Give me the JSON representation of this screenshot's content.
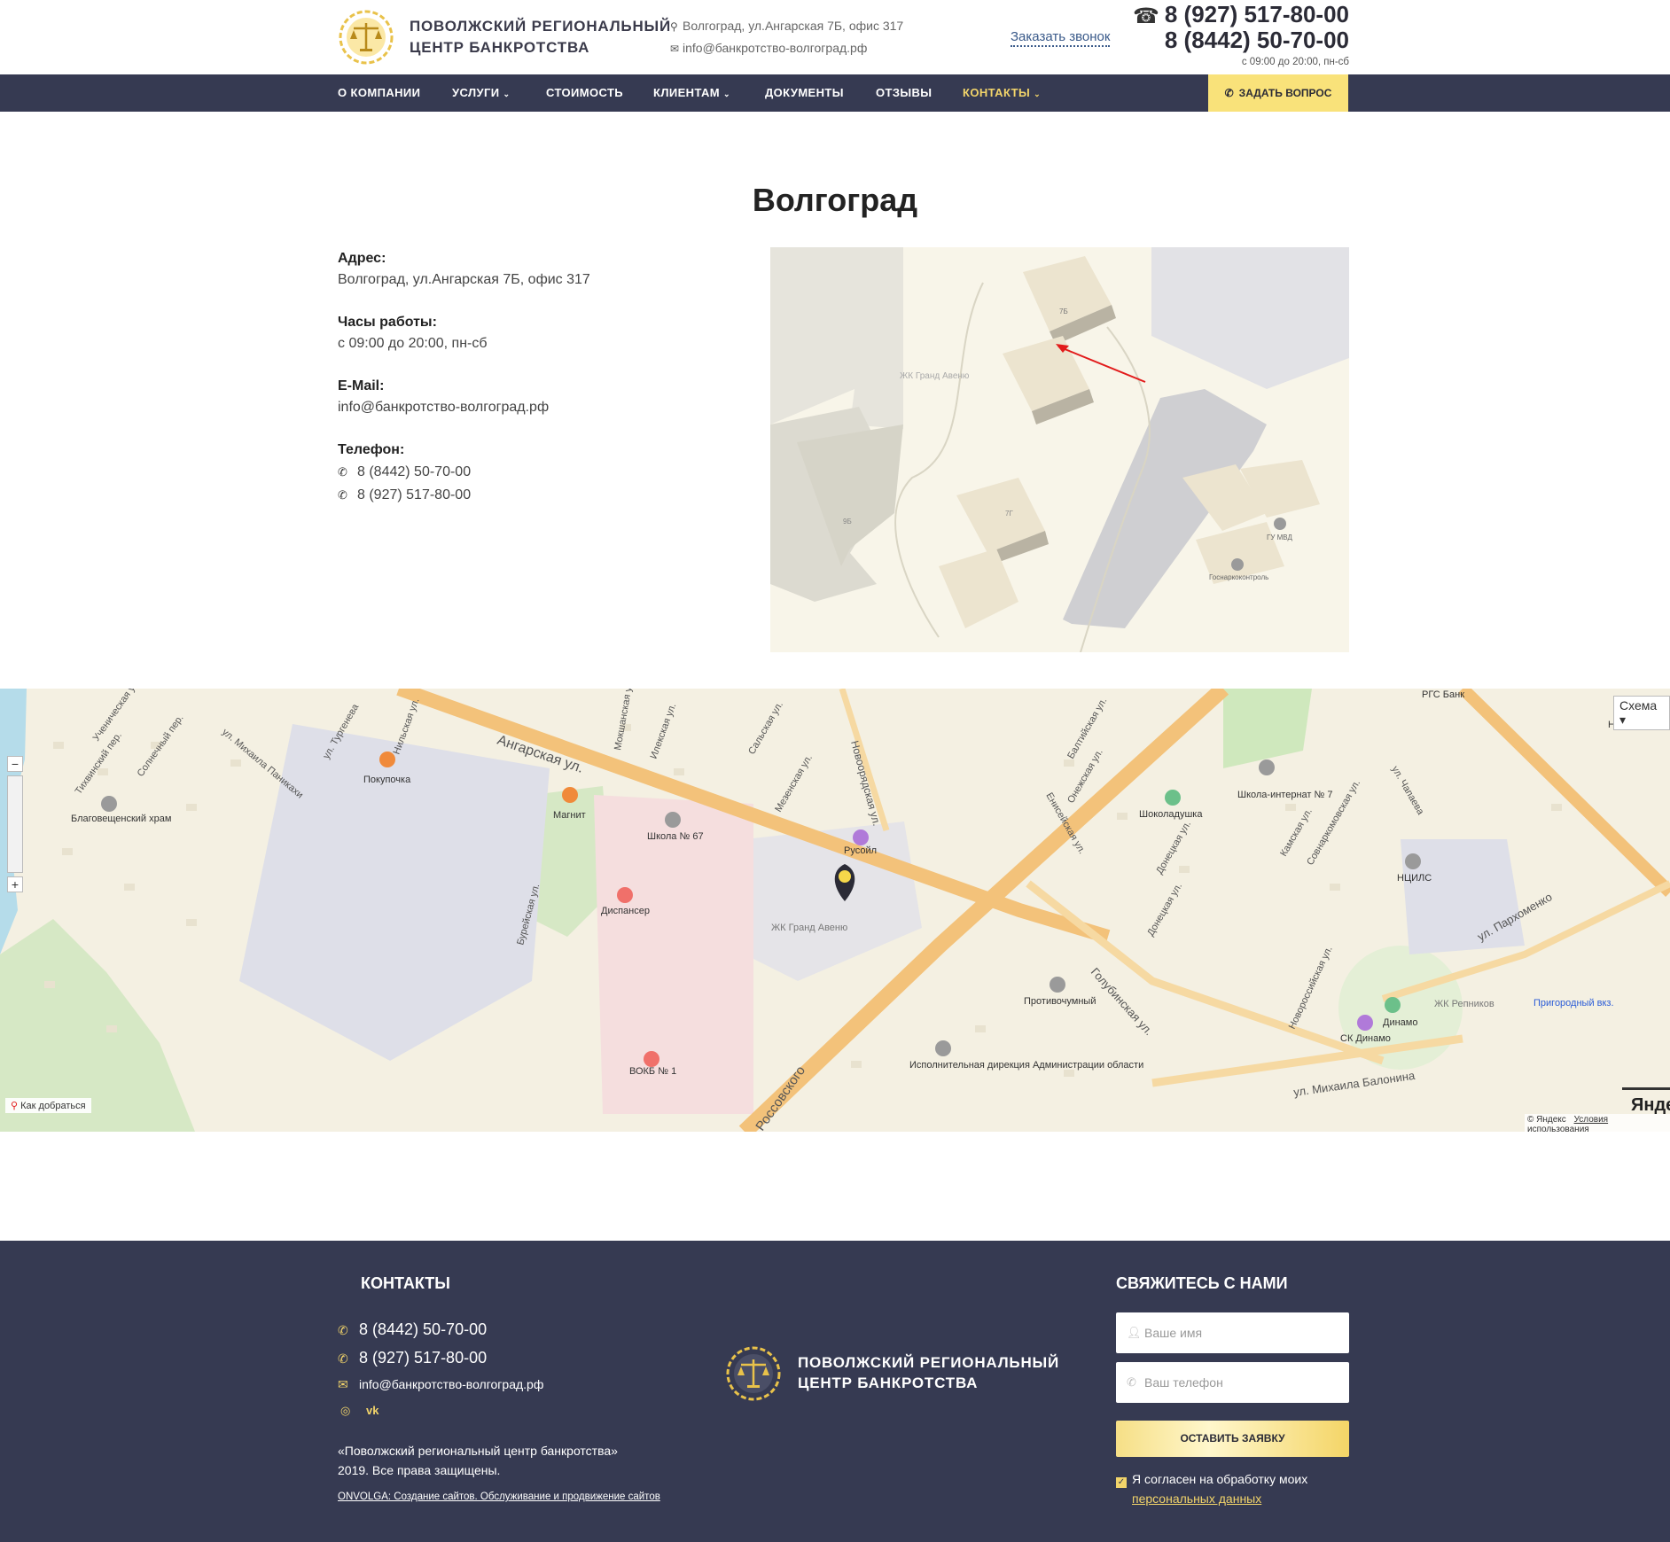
{
  "header": {
    "logo_line1": "Поволжский региональный",
    "logo_line2": "центр банкротства",
    "address": "Волгоград, ул.Ангарская 7Б, офис 317",
    "email": "info@банкротство-волгоград.рф",
    "callback": "Заказать звонок",
    "phone1": "8 (927) 517-80-00",
    "phone2": "8 (8442) 50-70-00",
    "hours": "с 09:00 до 20:00, пн-сб"
  },
  "nav": {
    "items": [
      {
        "label": "О компании"
      },
      {
        "label": "Услуги"
      },
      {
        "label": "Стоимость"
      },
      {
        "label": "Клиентам"
      },
      {
        "label": "Документы"
      },
      {
        "label": "Отзывы"
      },
      {
        "label": "Контакты"
      }
    ],
    "ask": "Задать вопрос"
  },
  "main": {
    "city": "Волгоград",
    "address_label": "Адрес:",
    "address": "Волгоград, ул.Ангарская 7Б, офис 317",
    "hours_label": "Часы работы:",
    "hours": "с 09:00 до 20:00, пн-сб",
    "email_label": "E-Mail:",
    "email": "info@банкротство-волгоград.рф",
    "phone_label": "Телефон:",
    "phones": [
      "8 (8442) 50-70-00",
      "8 (927) 517-80-00"
    ]
  },
  "photo_map": {
    "labels": [
      "7Б",
      "ЖК Гранд Авеню",
      "7Г",
      "9Б",
      "ГУ МВД",
      "Госнаркоконтроль"
    ]
  },
  "map": {
    "scheme": "Схема",
    "route": "Как добраться",
    "copyright": "© Яндекс",
    "terms": "Условия использования",
    "brand": "Яндекс",
    "streets": [
      "Ангарская ул.",
      "Новоорядская ул.",
      "Голубинская ул.",
      "ул. Михаила Балонина",
      "ул. Пархоменко",
      "Новороссийская ул.",
      "Донецкая ул.",
      "Бурейская ул.",
      "Нильская ул.",
      "ул. Тургенева",
      "ул. Михаила Паникахи",
      "Солнечный пер.",
      "Тихвинский пер.",
      "Ученическая ул.",
      "Онежская ул.",
      "Енисейская ул.",
      "Балтийская ул.",
      "Камская ул.",
      "Совнаркомовская ул.",
      "ул. Чапаева",
      "Мезенская ул.",
      "Сальская ул.",
      "Илекская ул.",
      "Мокшанская ул.",
      "Донецкая ул.",
      "Россовского"
    ],
    "pois": [
      "Покупочка",
      "Магнит",
      "Благовещенский храм",
      "Школа № 67",
      "Русойл",
      "Диспансер",
      "ЖК Гранд Авеню",
      "Шоколадушка",
      "Школа-интернат № 7",
      "НЦИЛС",
      "Противочумный",
      "Исполнительная дирекция Администрации области",
      "ВОКБ № 1",
      "СК Динамо",
      "Динамо",
      "ЖК Репников",
      "Пригородный вкз.",
      "Новороссийский рынок",
      "РГС Банк"
    ]
  },
  "footer": {
    "contacts_title": "Контакты",
    "phone1": "8 (8442) 50-70-00",
    "phone2": "8 (927) 517-80-00",
    "email": "info@банкротство-волгоград.рф",
    "copyright_line1": "«Поволжский региональный центр банкротства»",
    "copyright_line2": "2019. Все права защищены.",
    "dev_link": "ONVOLGA: Создание сайтов. Обслуживание и продвижение сайтов",
    "logo_line1": "Поволжский региональный",
    "logo_line2": "центр банкротства",
    "form_title": "Свяжитесь с нами",
    "name_placeholder": "Ваше имя",
    "phone_placeholder": "Ваш телефон",
    "submit": "Оставить заявку",
    "agree_text": "Я согласен на обработку моих",
    "agree_link": "персональных данных"
  },
  "colors": {
    "nav_bg": "#363a52",
    "accent": "#f2d46a",
    "button": "#f9e27a"
  }
}
